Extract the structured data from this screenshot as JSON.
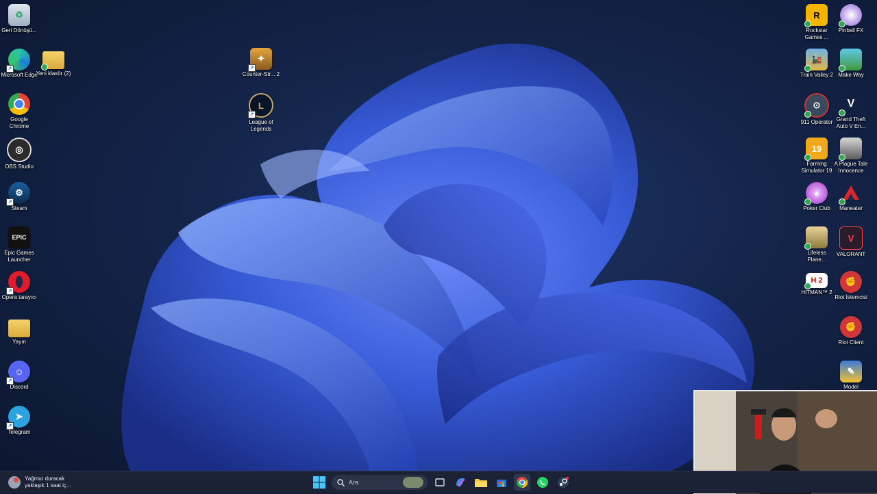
{
  "desktop": {
    "left_icons": [
      {
        "label": "Geri Dönüşü...",
        "icon": "recycle-bin-icon"
      },
      {
        "label": "Microsoft Edge",
        "icon": "edge-icon"
      },
      {
        "label": "Google Chrome",
        "icon": "chrome-icon"
      },
      {
        "label": "OBS Studio",
        "icon": "obs-icon"
      },
      {
        "label": "Steam",
        "icon": "steam-icon"
      },
      {
        "label": "Epic Games Launcher",
        "icon": "epic-games-icon"
      },
      {
        "label": "Opera tarayıcı",
        "icon": "opera-icon"
      },
      {
        "label": "Yayın",
        "icon": "folder-icon"
      },
      {
        "label": "Discord",
        "icon": "discord-icon"
      },
      {
        "label": "Telegram",
        "icon": "telegram-icon"
      }
    ],
    "folder_icon": {
      "label": "Yeni klasör (2)",
      "icon": "folder-icon"
    },
    "middle_icons": [
      {
        "label": "Counter-Str... 2",
        "icon": "counter-strike-icon"
      },
      {
        "label": "League of Legends",
        "icon": "league-of-legends-icon"
      }
    ],
    "right_icons": [
      {
        "label": "Rockstar Games ...",
        "icon": "rockstar-icon"
      },
      {
        "label": "Pinball FX",
        "icon": "pinball-icon"
      },
      {
        "label": "Train Valley 2",
        "icon": "train-valley-icon"
      },
      {
        "label": "Make Way",
        "icon": "make-way-icon"
      },
      {
        "label": "911 Operator",
        "icon": "operator-911-icon"
      },
      {
        "label": "Grand Theft Auto V En...",
        "icon": "gta-icon"
      },
      {
        "label": "Farming Simulator 19",
        "icon": "farming-sim-icon"
      },
      {
        "label": "A Plague Tale Innocence",
        "icon": "plague-tale-icon"
      },
      {
        "label": "Poker Club",
        "icon": "poker-club-icon"
      },
      {
        "label": "Maneater",
        "icon": "maneater-icon"
      },
      {
        "label": "Lifeless Plane...",
        "icon": "lifeless-planet-icon"
      },
      {
        "label": "VALORANT",
        "icon": "valorant-icon"
      },
      {
        "label": "HITMAN™ 2",
        "icon": "hitman-icon"
      },
      {
        "label": "Riot İstemcisi",
        "icon": "riot-icon"
      },
      {
        "label": "Riot Client",
        "icon": "riot-icon"
      },
      {
        "label": "Model",
        "icon": "model-icon"
      }
    ]
  },
  "taskbar": {
    "weather_line1": "Yağmur duracak",
    "weather_line2": "yaklaşık 1 saat iç...",
    "search_placeholder": "Ara",
    "apps": [
      "start-icon",
      "search-icon",
      "task-view-icon",
      "copilot-icon",
      "file-explorer-icon",
      "store-icon",
      "chrome-icon",
      "whatsapp-icon",
      "steam-icon"
    ]
  },
  "colors": {
    "wallpaper_bloom": "#3a5fe0",
    "taskbar": "#1c2235",
    "check_badge": "#2fa84f"
  }
}
